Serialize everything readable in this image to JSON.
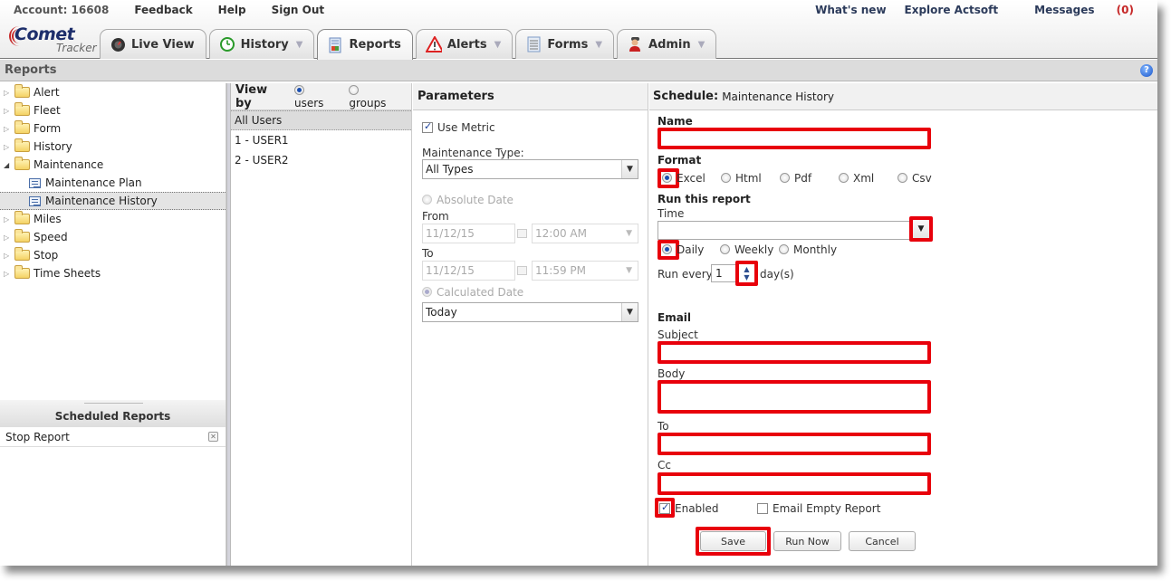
{
  "header": {
    "account": "Account: 16608",
    "links_left": [
      "Feedback",
      "Help",
      "Sign Out"
    ],
    "links_right": [
      "What's new",
      "Explore Actsoft"
    ],
    "messages_label": "Messages",
    "messages_count": "(0)",
    "logo_main": "Comet",
    "logo_sub": "Tracker"
  },
  "tabs": [
    {
      "label": "Live View",
      "icon": "live-view-icon",
      "has_dropdown": false,
      "active": false
    },
    {
      "label": "History",
      "icon": "clock-icon",
      "has_dropdown": true,
      "active": false
    },
    {
      "label": "Reports",
      "icon": "reports-icon",
      "has_dropdown": false,
      "active": true
    },
    {
      "label": "Alerts",
      "icon": "warning-icon",
      "has_dropdown": true,
      "active": false
    },
    {
      "label": "Forms",
      "icon": "document-icon",
      "has_dropdown": true,
      "active": false
    },
    {
      "label": "Admin",
      "icon": "admin-user-icon",
      "has_dropdown": true,
      "active": false
    }
  ],
  "reports_bar": {
    "title": "Reports",
    "help": "?"
  },
  "tree": {
    "items": [
      {
        "label": "Alert",
        "type": "folder",
        "expanded": false
      },
      {
        "label": "Fleet",
        "type": "folder",
        "expanded": false
      },
      {
        "label": "Form",
        "type": "folder",
        "expanded": false
      },
      {
        "label": "History",
        "type": "folder",
        "expanded": false
      },
      {
        "label": "Maintenance",
        "type": "folder",
        "expanded": true
      },
      {
        "label": "Maintenance Plan",
        "type": "report"
      },
      {
        "label": "Maintenance History",
        "type": "report",
        "selected": true
      },
      {
        "label": "Miles",
        "type": "folder",
        "expanded": false
      },
      {
        "label": "Speed",
        "type": "folder",
        "expanded": false
      },
      {
        "label": "Stop",
        "type": "folder",
        "expanded": false
      },
      {
        "label": "Time Sheets",
        "type": "folder",
        "expanded": false
      }
    ]
  },
  "scheduled_reports": {
    "title": "Scheduled Reports",
    "items": [
      {
        "label": "Stop Report"
      }
    ]
  },
  "users_panel": {
    "view_by": "View by",
    "options": [
      "users",
      "groups"
    ],
    "selected_option": "users",
    "rows": [
      "All Users",
      "1 - USER1",
      "2 - USER2"
    ],
    "selected_row": "All Users"
  },
  "parameters": {
    "title": "Parameters",
    "use_metric": {
      "label": "Use Metric",
      "checked": true
    },
    "maintenance_type_label": "Maintenance Type:",
    "maintenance_type_value": "All Types",
    "absolute_date_label": "Absolute Date",
    "from_label": "From",
    "from_date": "11/12/15",
    "from_time": "12:00 AM",
    "to_label": "To",
    "to_date": "11/12/15",
    "to_time": "11:59 PM",
    "calculated_date_label": "Calculated Date",
    "calculated_value": "Today"
  },
  "schedule": {
    "title_bold": "Schedule:",
    "title_rest": "Maintenance History",
    "name_label": "Name",
    "name_value": "",
    "format_label": "Format",
    "formats": [
      "Excel",
      "Html",
      "Pdf",
      "Xml",
      "Csv"
    ],
    "selected_format": "Excel",
    "run_label": "Run this report",
    "time_label": "Time",
    "time_value": "",
    "frequencies": [
      "Daily",
      "Weekly",
      "Monthly"
    ],
    "selected_frequency": "Daily",
    "run_every_label": "Run every",
    "run_every_value": "1",
    "run_every_unit": "day(s)",
    "email_label": "Email",
    "subject_label": "Subject",
    "body_label": "Body",
    "to_label": "To",
    "cc_label": "Cc",
    "enabled_label": "Enabled",
    "enabled_checked": true,
    "email_empty_label": "Email Empty Report",
    "email_empty_checked": false,
    "buttons": {
      "save": "Save",
      "run_now": "Run Now",
      "cancel": "Cancel"
    },
    "highlight_color": "#e8000b"
  }
}
